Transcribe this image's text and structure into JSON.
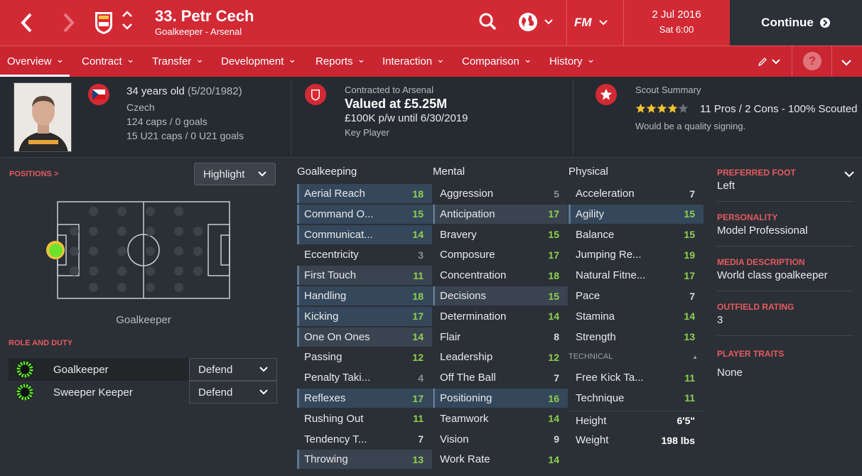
{
  "header": {
    "player_name": "33. Petr Cech",
    "player_subtitle": "Goalkeeper - Arsenal",
    "date": "2 Jul 2016",
    "time": "Sat 6:00",
    "continue_label": "Continue",
    "fm_logo": "FM"
  },
  "nav": {
    "tabs": [
      "Overview",
      "Contract",
      "Transfer",
      "Development",
      "Reports",
      "Interaction",
      "Comparison",
      "History"
    ]
  },
  "profile": {
    "age": "34 years old",
    "dob": "(5/20/1982)",
    "nationality": "Czech",
    "caps": "124 caps / 0 goals",
    "u21_caps": "15 U21 caps / 0 U21 goals"
  },
  "contract": {
    "label": "Contracted to Arsenal",
    "value": "Valued at £5.25M",
    "wage": "£100K p/w until 6/30/2019",
    "status": "Key Player"
  },
  "scout": {
    "label": "Scout Summary",
    "stars": 4,
    "summary": "11 Pros / 2 Cons - 100% Scouted",
    "verdict": "Would be a quality signing."
  },
  "positions": {
    "title": "POSITIONS >",
    "highlight_label": "Highlight",
    "position_name": "Goalkeeper"
  },
  "roles": {
    "title": "ROLE AND DUTY",
    "items": [
      {
        "role": "Goalkeeper",
        "duty": "Defend"
      },
      {
        "role": "Sweeper Keeper",
        "duty": "Defend"
      }
    ]
  },
  "goalkeeping": {
    "title": "Goalkeeping",
    "attrs": [
      {
        "name": "Aerial Reach",
        "value": "18"
      },
      {
        "name": "Command O...",
        "value": "15"
      },
      {
        "name": "Communicat...",
        "value": "14"
      },
      {
        "name": "Eccentricity",
        "value": "3"
      },
      {
        "name": "First Touch",
        "value": "11"
      },
      {
        "name": "Handling",
        "value": "18"
      },
      {
        "name": "Kicking",
        "value": "17"
      },
      {
        "name": "One On Ones",
        "value": "14"
      },
      {
        "name": "Passing",
        "value": "12"
      },
      {
        "name": "Penalty Taki...",
        "value": "4"
      },
      {
        "name": "Reflexes",
        "value": "17"
      },
      {
        "name": "Rushing Out",
        "value": "11"
      },
      {
        "name": "Tendency T...",
        "value": "7"
      },
      {
        "name": "Throwing",
        "value": "13"
      }
    ]
  },
  "mental": {
    "title": "Mental",
    "attrs": [
      {
        "name": "Aggression",
        "value": "5"
      },
      {
        "name": "Anticipation",
        "value": "17"
      },
      {
        "name": "Bravery",
        "value": "15"
      },
      {
        "name": "Composure",
        "value": "17"
      },
      {
        "name": "Concentration",
        "value": "18"
      },
      {
        "name": "Decisions",
        "value": "15"
      },
      {
        "name": "Determination",
        "value": "14"
      },
      {
        "name": "Flair",
        "value": "8"
      },
      {
        "name": "Leadership",
        "value": "12"
      },
      {
        "name": "Off The Ball",
        "value": "7"
      },
      {
        "name": "Positioning",
        "value": "16"
      },
      {
        "name": "Teamwork",
        "value": "14"
      },
      {
        "name": "Vision",
        "value": "9"
      },
      {
        "name": "Work Rate",
        "value": "14"
      }
    ]
  },
  "physical": {
    "title": "Physical",
    "attrs": [
      {
        "name": "Acceleration",
        "value": "7"
      },
      {
        "name": "Agility",
        "value": "15"
      },
      {
        "name": "Balance",
        "value": "15"
      },
      {
        "name": "Jumping Re...",
        "value": "19"
      },
      {
        "name": "Natural Fitne...",
        "value": "17"
      },
      {
        "name": "Pace",
        "value": "7"
      },
      {
        "name": "Stamina",
        "value": "14"
      },
      {
        "name": "Strength",
        "value": "13"
      }
    ],
    "technical_title": "TECHNICAL",
    "technical": [
      {
        "name": "Free Kick Ta...",
        "value": "11"
      },
      {
        "name": "Technique",
        "value": "11"
      }
    ],
    "height_label": "Height",
    "height": "6'5\"",
    "weight_label": "Weight",
    "weight": "198 lbs"
  },
  "details": {
    "foot_label": "PREFERRED FOOT",
    "foot": "Left",
    "personality_label": "PERSONALITY",
    "personality": "Model Professional",
    "media_label": "MEDIA DESCRIPTION",
    "media": "World class goalkeeper",
    "outfield_label": "OUTFIELD RATING",
    "outfield": "3",
    "traits_label": "PLAYER TRAITS",
    "traits": "None"
  },
  "colors": {
    "brand_red": "#d22a35",
    "good": "#8fd14f",
    "neutral": "#d6d9dc",
    "poor": "#8a9097"
  }
}
